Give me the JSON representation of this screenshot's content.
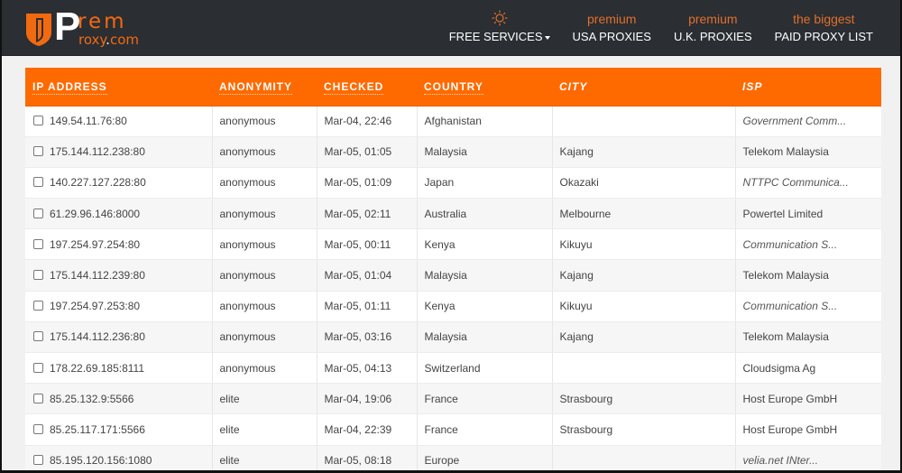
{
  "brand": {
    "letter": "P",
    "suffix_top": "rem",
    "suffix_bottom_pre": "roxy",
    "suffix_bottom_dot": ".",
    "suffix_bottom_post": "com",
    "accent_color": "#f26a10",
    "header_bg": "#2b2e33"
  },
  "nav": [
    {
      "top": "",
      "icon": "sun-icon",
      "label": "FREE SERVICES",
      "has_dropdown": true
    },
    {
      "top": "premium",
      "label": "USA PROXIES"
    },
    {
      "top": "premium",
      "label": "U.K. PROXIES"
    },
    {
      "top": "the biggest",
      "label": "PAID PROXY LIST"
    }
  ],
  "table": {
    "header_color": "#ff6a00",
    "columns": [
      "IP ADDRESS",
      "ANONYMITY",
      "CHECKED",
      "COUNTRY",
      "CITY",
      "ISP"
    ],
    "rows": [
      {
        "ip": "149.54.11.76:80",
        "anonymity": "anonymous",
        "checked": "Mar-04, 22:46",
        "country": "Afghanistan",
        "city": "",
        "isp": "Government Comm...",
        "isp_italic": true
      },
      {
        "ip": "175.144.112.238:80",
        "anonymity": "anonymous",
        "checked": "Mar-05, 01:05",
        "country": "Malaysia",
        "city": "Kajang",
        "isp": "Telekom Malaysia",
        "isp_italic": false
      },
      {
        "ip": "140.227.127.228:80",
        "anonymity": "anonymous",
        "checked": "Mar-05, 01:09",
        "country": "Japan",
        "city": "Okazaki",
        "isp": "NTTPC Communica...",
        "isp_italic": true
      },
      {
        "ip": "61.29.96.146:8000",
        "anonymity": "anonymous",
        "checked": "Mar-05, 02:11",
        "country": "Australia",
        "city": "Melbourne",
        "isp": "Powertel Limited",
        "isp_italic": false
      },
      {
        "ip": "197.254.97.254:80",
        "anonymity": "anonymous",
        "checked": "Mar-05, 00:11",
        "country": "Kenya",
        "city": "Kikuyu",
        "isp": "Communication S...",
        "isp_italic": true
      },
      {
        "ip": "175.144.112.239:80",
        "anonymity": "anonymous",
        "checked": "Mar-05, 01:04",
        "country": "Malaysia",
        "city": "Kajang",
        "isp": "Telekom Malaysia",
        "isp_italic": false
      },
      {
        "ip": "197.254.97.253:80",
        "anonymity": "anonymous",
        "checked": "Mar-05, 01:11",
        "country": "Kenya",
        "city": "Kikuyu",
        "isp": "Communication S...",
        "isp_italic": true
      },
      {
        "ip": "175.144.112.236:80",
        "anonymity": "anonymous",
        "checked": "Mar-05, 03:16",
        "country": "Malaysia",
        "city": "Kajang",
        "isp": "Telekom Malaysia",
        "isp_italic": false
      },
      {
        "ip": "178.22.69.185:8111",
        "anonymity": "anonymous",
        "checked": "Mar-05, 04:13",
        "country": "Switzerland",
        "city": "",
        "isp": "Cloudsigma Ag",
        "isp_italic": false
      },
      {
        "ip": "85.25.132.9:5566",
        "anonymity": "elite",
        "checked": "Mar-04, 19:06",
        "country": "France",
        "city": "Strasbourg",
        "isp": "Host Europe GmbH",
        "isp_italic": false
      },
      {
        "ip": "85.25.117.171:5566",
        "anonymity": "elite",
        "checked": "Mar-04, 22:39",
        "country": "France",
        "city": "Strasbourg",
        "isp": "Host Europe GmbH",
        "isp_italic": false
      },
      {
        "ip": "85.195.120.156:1080",
        "anonymity": "elite",
        "checked": "Mar-05, 08:18",
        "country": "Europe",
        "city": "",
        "isp": "velia.net INter...",
        "isp_italic": true
      }
    ]
  }
}
